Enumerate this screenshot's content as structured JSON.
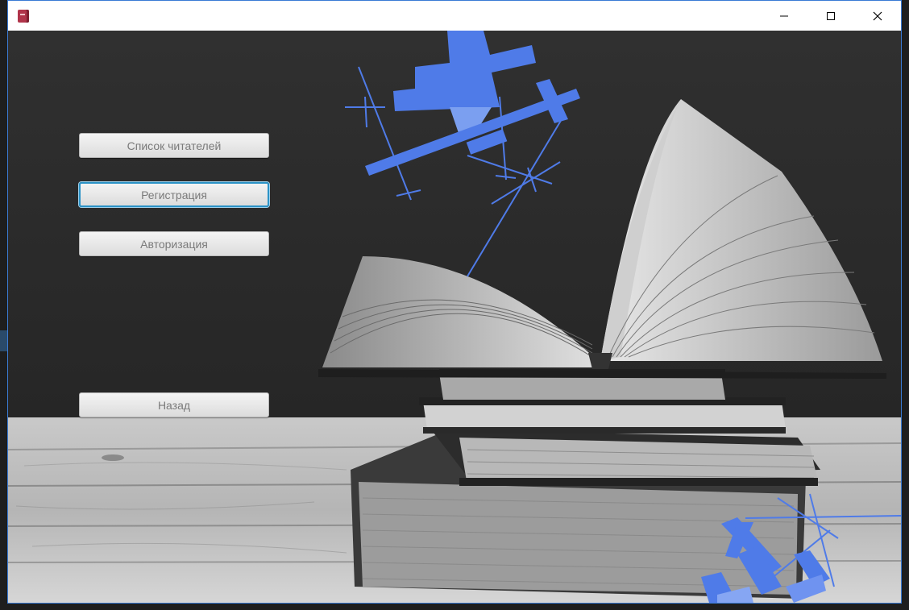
{
  "window": {
    "title": "",
    "controls": {
      "minimize_icon": "minimize-icon",
      "maximize_icon": "maximize-icon",
      "close_icon": "close-icon"
    }
  },
  "menu": {
    "readers_list_label": "Список читателей",
    "registration_label": "Регистрация",
    "authorization_label": "Авторизация",
    "back_label": "Назад"
  },
  "colors": {
    "accent": "#2c93c7",
    "constructivist_blue": "#4f7be8",
    "board": "#2d2d2d",
    "table": "#cfcfcf"
  }
}
